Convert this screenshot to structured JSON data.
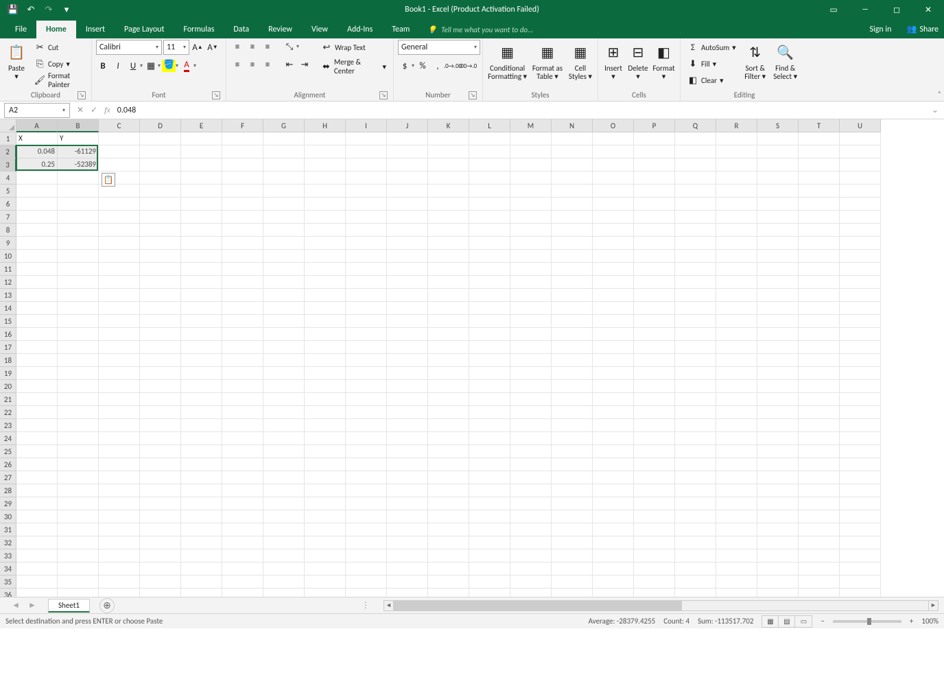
{
  "title": "Book1 - Excel (Product Activation Failed)",
  "signin": "Sign in",
  "share": "Share",
  "tabs": [
    "File",
    "Home",
    "Insert",
    "Page Layout",
    "Formulas",
    "Data",
    "Review",
    "View",
    "Add-Ins",
    "Team"
  ],
  "tellme": "Tell me what you want to do...",
  "clipboard": {
    "label": "Clipboard",
    "paste": "Paste",
    "cut": "Cut",
    "copy": "Copy",
    "fp": "Format Painter"
  },
  "font": {
    "label": "Font",
    "name": "Calibri",
    "size": "11"
  },
  "alignment": {
    "label": "Alignment",
    "wrap": "Wrap Text",
    "merge": "Merge & Center"
  },
  "number": {
    "label": "Number",
    "fmt": "General"
  },
  "styles": {
    "label": "Styles",
    "cf": "Conditional Formatting",
    "fat": "Format as Table",
    "cs": "Cell Styles"
  },
  "cells": {
    "label": "Cells",
    "ins": "Insert",
    "del": "Delete",
    "fmt": "Format"
  },
  "editing": {
    "label": "Editing",
    "sum": "AutoSum",
    "fill": "Fill",
    "clear": "Clear",
    "sort": "Sort & Filter",
    "find": "Find & Select"
  },
  "namebox": "A2",
  "formula": "0.048",
  "cols": [
    "A",
    "B",
    "C",
    "D",
    "E",
    "F",
    "G",
    "H",
    "I",
    "J",
    "K",
    "L",
    "M",
    "N",
    "O",
    "P",
    "Q",
    "R",
    "S",
    "T",
    "U"
  ],
  "rows_count": 37,
  "data": {
    "A1": "X",
    "B1": "Y",
    "A2": "0.048",
    "B2": "-61129",
    "A3": "0.25",
    "B3": "-52389"
  },
  "selected_cols": [
    "A",
    "B"
  ],
  "selected_rows": [
    2,
    3
  ],
  "sheet": "Sheet1",
  "status": "Select destination and press ENTER or choose Paste",
  "agg": {
    "avg": "Average: -28379.4255",
    "count": "Count: 4",
    "sum": "Sum: -113517.702"
  },
  "zoom": "100%"
}
